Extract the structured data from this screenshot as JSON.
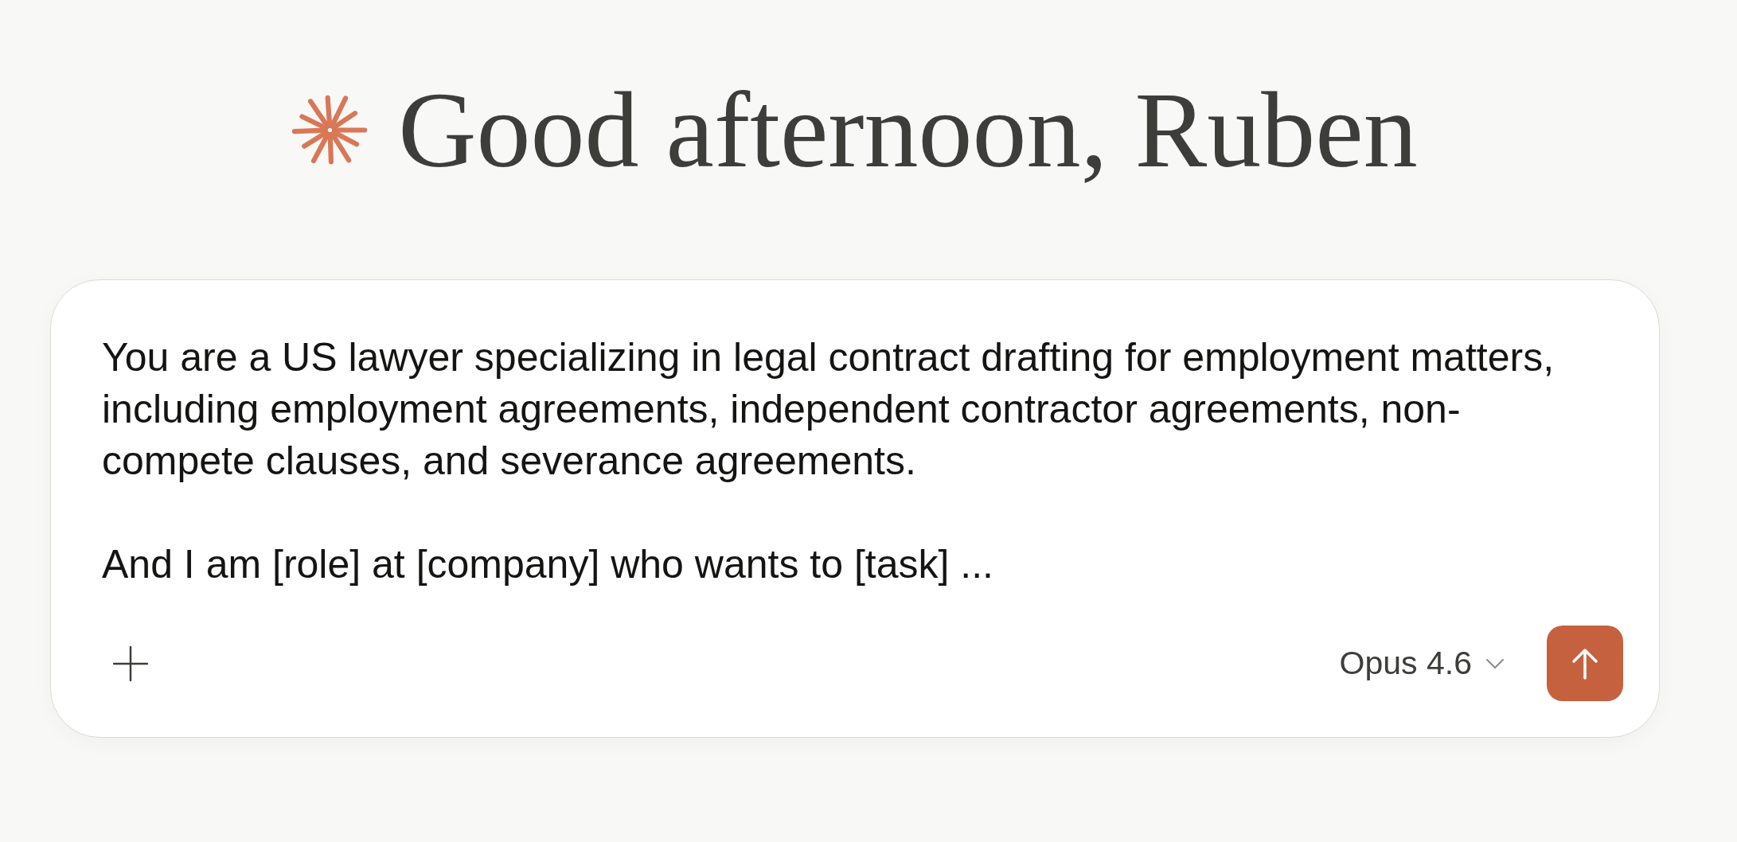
{
  "greeting": {
    "text": "Good afternoon, Ruben"
  },
  "composer": {
    "value": "You are a US lawyer specializing in legal contract drafting for employment matters, including employment agreements, independent contractor agreements, non-compete clauses, and severance agreements.\n\nAnd I am [role] at [company] who wants to [task] ...",
    "model": "Opus 4.6"
  }
}
